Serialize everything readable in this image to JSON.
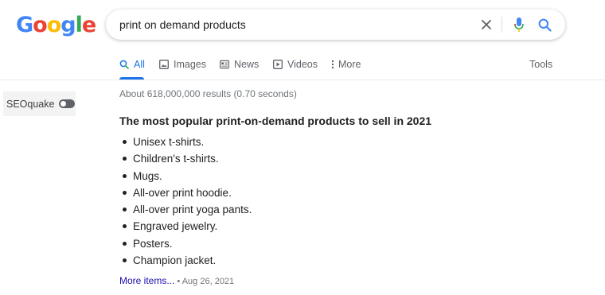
{
  "logo": {
    "letters": [
      {
        "char": "G",
        "color": "#4285F4"
      },
      {
        "char": "o",
        "color": "#EA4335"
      },
      {
        "char": "o",
        "color": "#FBBC05"
      },
      {
        "char": "g",
        "color": "#4285F4"
      },
      {
        "char": "l",
        "color": "#34A853"
      },
      {
        "char": "e",
        "color": "#EA4335"
      }
    ]
  },
  "search": {
    "query": "print on demand products",
    "clear_icon": "close-icon",
    "voice_icon": "microphone-icon",
    "search_icon": "search-icon"
  },
  "tabs": {
    "items": [
      {
        "label": "All",
        "icon": "search-icon",
        "active": true
      },
      {
        "label": "Images",
        "icon": "image-icon",
        "active": false
      },
      {
        "label": "News",
        "icon": "news-icon",
        "active": false
      },
      {
        "label": "Videos",
        "icon": "video-icon",
        "active": false
      },
      {
        "label": "More",
        "icon": "more-vertical-icon",
        "active": false
      }
    ],
    "tools_label": "Tools"
  },
  "seoquake": {
    "label": "SEOquake",
    "toggle_state": "off"
  },
  "results": {
    "stats": "About 618,000,000 results (0.70 seconds)",
    "snippet": {
      "title": "The most popular print-on-demand products to sell in 2021",
      "items": [
        "Unisex t-shirts.",
        "Children's t-shirts.",
        "Mugs.",
        "All-over print hoodie.",
        "All-over print yoga pants.",
        "Engraved jewelry.",
        "Posters.",
        "Champion jacket."
      ],
      "more_label": "More items...",
      "separator": " • ",
      "date": "Aug 26, 2021"
    }
  },
  "colors": {
    "accent": "#1a73e8",
    "link": "#1a0dab",
    "muted": "#70757a",
    "text": "#202124"
  }
}
